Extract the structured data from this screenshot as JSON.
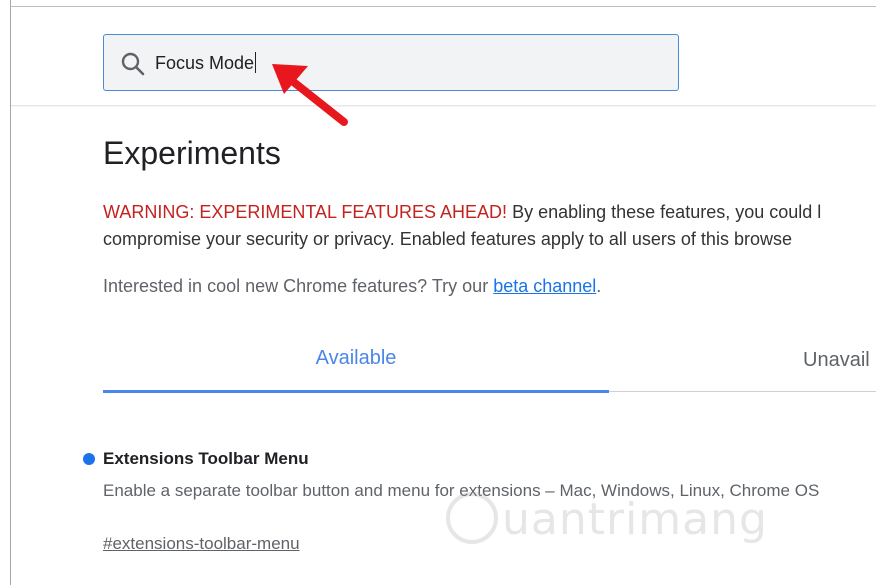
{
  "search": {
    "value": "Focus Mode",
    "icon": "search-icon"
  },
  "page": {
    "title": "Experiments"
  },
  "warning": {
    "label": "WARNING: EXPERIMENTAL FEATURES AHEAD!",
    "line1_rest": " By enabling these features, you could l",
    "line2": "compromise your security or privacy. Enabled features apply to all users of this browse"
  },
  "interested": {
    "text": "Interested in cool new Chrome features? Try our ",
    "link": "beta channel",
    "suffix": "."
  },
  "tabs": {
    "available": "Available",
    "unavailable": "Unavail"
  },
  "feature": {
    "name": "Extensions Toolbar Menu",
    "description": "Enable a separate toolbar button and menu for extensions – Mac, Windows, Linux, Chrome OS",
    "link": "#extensions-toolbar-menu"
  },
  "colors": {
    "accent": "#4a86e8",
    "warning": "#c5221f",
    "arrow": "#e8171d"
  },
  "watermark": {
    "text": "uantrimang"
  }
}
